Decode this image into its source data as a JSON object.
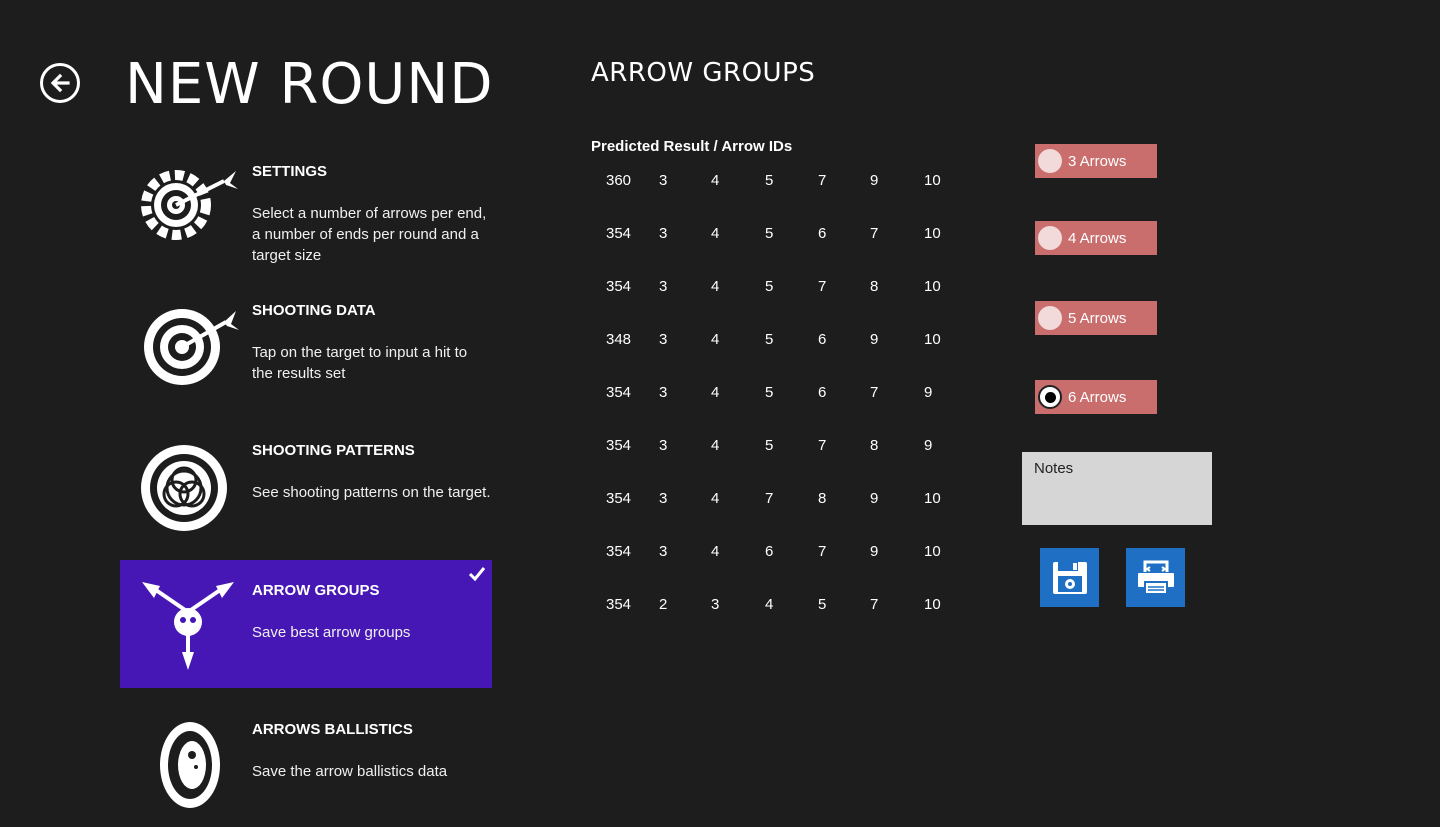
{
  "header": {
    "title": "NEW ROUND"
  },
  "menu": [
    {
      "title": "SETTINGS",
      "desc": "Select a number of arrows per end, a number of ends per round and a target size",
      "selected": false
    },
    {
      "title": "SHOOTING DATA",
      "desc": "Tap on the target to input a hit to the results set",
      "selected": false
    },
    {
      "title": "SHOOTING PATTERNS",
      "desc": "See shooting patterns on the target.",
      "selected": false
    },
    {
      "title": "ARROW GROUPS",
      "desc": "Save best arrow groups",
      "selected": true
    },
    {
      "title": "ARROWS BALLISTICS",
      "desc": "Save the arrow ballistics data",
      "selected": false
    }
  ],
  "section": {
    "title": "ARROW GROUPS",
    "table_header": "Predicted Result / Arrow IDs"
  },
  "groups": [
    [
      "360",
      "3",
      "4",
      "5",
      "7",
      "9",
      "10"
    ],
    [
      "354",
      "3",
      "4",
      "5",
      "6",
      "7",
      "10"
    ],
    [
      "354",
      "3",
      "4",
      "5",
      "7",
      "8",
      "10"
    ],
    [
      "348",
      "3",
      "4",
      "5",
      "6",
      "9",
      "10"
    ],
    [
      "354",
      "3",
      "4",
      "5",
      "6",
      "7",
      "9"
    ],
    [
      "354",
      "3",
      "4",
      "5",
      "7",
      "8",
      "9"
    ],
    [
      "354",
      "3",
      "4",
      "7",
      "8",
      "9",
      "10"
    ],
    [
      "354",
      "3",
      "4",
      "6",
      "7",
      "9",
      "10"
    ],
    [
      "354",
      "2",
      "3",
      "4",
      "5",
      "7",
      "10"
    ]
  ],
  "arrow_options": [
    {
      "label": "3 Arrows",
      "selected": false
    },
    {
      "label": "4 Arrows",
      "selected": false
    },
    {
      "label": "5 Arrows",
      "selected": false
    },
    {
      "label": "6 Arrows",
      "selected": true
    }
  ],
  "notes": {
    "label": "Notes"
  },
  "actions": {
    "save_icon": "floppy-disk-icon",
    "print_icon": "printer-icon"
  },
  "colors": {
    "background": "#1d1d1d",
    "selected_menu": "#4617b4",
    "radio_bg": "#c96d6d",
    "action_tile": "#1f70c5",
    "notes_bg": "#d6d6d6"
  }
}
